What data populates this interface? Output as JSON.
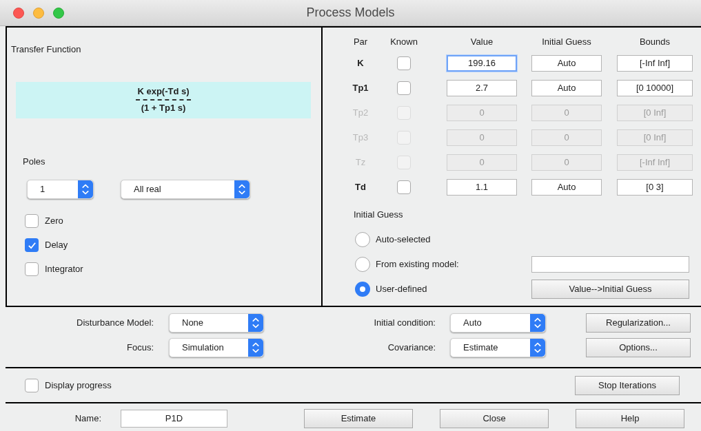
{
  "window": {
    "title": "Process Models"
  },
  "transfer_function": {
    "label": "Transfer Function",
    "numerator": "K exp(-Td s)",
    "denominator": "(1 + Tp1 s)"
  },
  "poles": {
    "label": "Poles",
    "count": "1",
    "type": "All real"
  },
  "options": [
    {
      "label": "Zero",
      "checked": false
    },
    {
      "label": "Delay",
      "checked": true
    },
    {
      "label": "Integrator",
      "checked": false
    }
  ],
  "parameters": {
    "columns": [
      "Par",
      "Known",
      "Value",
      "Initial Guess",
      "Bounds"
    ],
    "rows": [
      {
        "par": "K",
        "enabled": true,
        "known": false,
        "value": "199.16",
        "focused": true,
        "initial_guess": "Auto",
        "bounds": "[-Inf Inf]"
      },
      {
        "par": "Tp1",
        "enabled": true,
        "known": false,
        "value": "2.7",
        "focused": false,
        "initial_guess": "Auto",
        "bounds": "[0 10000]"
      },
      {
        "par": "Tp2",
        "enabled": false,
        "known": false,
        "value": "0",
        "focused": false,
        "initial_guess": "0",
        "bounds": "[0 Inf]"
      },
      {
        "par": "Tp3",
        "enabled": false,
        "known": false,
        "value": "0",
        "focused": false,
        "initial_guess": "0",
        "bounds": "[0 Inf]"
      },
      {
        "par": "Tz",
        "enabled": false,
        "known": false,
        "value": "0",
        "focused": false,
        "initial_guess": "0",
        "bounds": "[-Inf Inf]"
      },
      {
        "par": "Td",
        "enabled": true,
        "known": false,
        "value": "1.1",
        "focused": false,
        "initial_guess": "Auto",
        "bounds": "[0 3]"
      }
    ]
  },
  "initial_guess": {
    "label": "Initial Guess",
    "options": [
      {
        "label": "Auto-selected",
        "selected": false
      },
      {
        "label": "From existing model:",
        "selected": false
      },
      {
        "label": "User-defined",
        "selected": true
      }
    ],
    "button": "Value-->Initial Guess"
  },
  "settings": {
    "rows": [
      {
        "left_label": "Disturbance Model:",
        "left_value": "None",
        "right_label": "Initial condition:",
        "right_value": "Auto",
        "button": "Regularization..."
      },
      {
        "left_label": "Focus:",
        "left_value": "Simulation",
        "right_label": "Covariance:",
        "right_value": "Estimate",
        "button": "Options..."
      }
    ]
  },
  "progress": {
    "label": "Display progress",
    "checked": false,
    "button": "Stop Iterations"
  },
  "footer": {
    "name_label": "Name:",
    "name_value": "P1D",
    "buttons": [
      "Estimate",
      "Close",
      "Help"
    ]
  }
}
